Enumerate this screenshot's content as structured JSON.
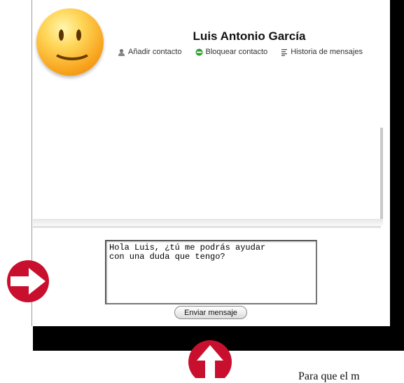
{
  "contact": {
    "name": "Luis Antonio García"
  },
  "actions": {
    "add_contact": "Añadir contacto",
    "block_contact": "Bloquear contacto",
    "message_history": "Historia de mensajes"
  },
  "message": {
    "text": "Hola Luis, ¿tú me podrás ayudar\ncon una duda que tengo?"
  },
  "send_button": {
    "label": "Enviar mensaje"
  },
  "caption": {
    "text": "Para que el m"
  },
  "icons": {
    "avatar": "smiley-face-icon",
    "add_contact": "person-icon",
    "block_contact": "green-block-icon",
    "message_history": "list-icon",
    "annotation_right": "red-arrow-right-icon",
    "annotation_up": "red-arrow-up-icon"
  },
  "colors": {
    "arrow_red": "#c8102e",
    "block_green": "#2e9e2e"
  }
}
